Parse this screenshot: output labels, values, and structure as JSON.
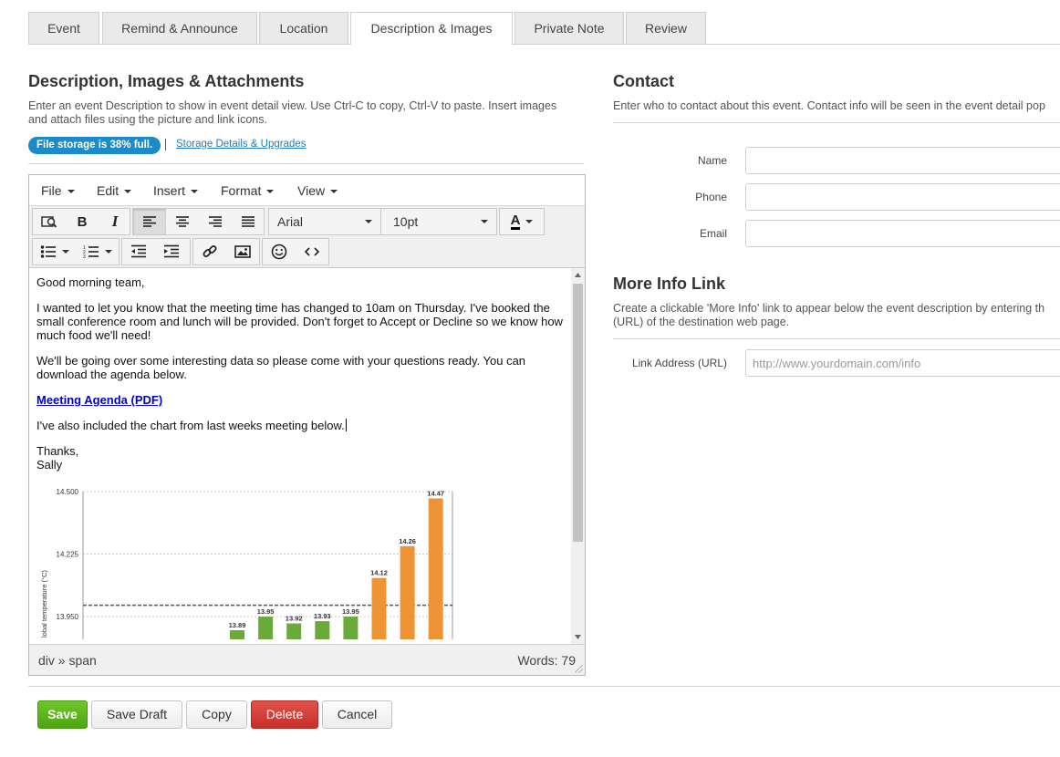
{
  "tabs": [
    {
      "label": "Event"
    },
    {
      "label": "Remind & Announce"
    },
    {
      "label": "Location"
    },
    {
      "label": "Description & Images"
    },
    {
      "label": "Private Note"
    },
    {
      "label": "Review"
    }
  ],
  "description_section": {
    "title": "Description, Images & Attachments",
    "help_text_1": "Enter an event Description to show in event detail view. Use Ctrl-C to copy, Ctrl-V to paste. Insert images",
    "help_text_2": "and attach files using the picture and link icons.",
    "storage_badge_prefix": "File storage is ",
    "storage_badge_percent": "38%",
    "storage_badge_suffix": " full.",
    "storage_link": "Storage Details & Upgrades"
  },
  "editor": {
    "menus": [
      "File",
      "Edit",
      "Insert",
      "Format",
      "View"
    ],
    "font_family": "Arial",
    "font_size": "10pt",
    "text_color_label": "A",
    "content": {
      "greeting": "Good morning team,",
      "para1": "I wanted to let you know that the meeting time has changed to 10am on Thursday. I've booked the small conference room and lunch will be provided. Don't forget to Accept or Decline so we know how much food we'll need!",
      "para2": "We'll be going over some interesting data so please come with your questions ready. You can download the agenda below.",
      "link": "Meeting Agenda (PDF)",
      "para3": "I've also included the chart from last weeks meeting below.",
      "signoff": "Thanks,",
      "signature": "Sally"
    },
    "status_path": "div » span",
    "word_count": "Words: 79"
  },
  "chart_data": {
    "type": "bar",
    "ylabel": "lobal temperature (°C)",
    "y_ticks": [
      "14.500",
      "14.225",
      "13.950"
    ],
    "ylim": [
      13.85,
      14.5
    ],
    "reference_line": 14.0,
    "values": [
      13.89,
      13.95,
      13.92,
      13.93,
      13.95,
      14.12,
      14.26,
      14.47
    ],
    "labels": [
      "13.89",
      "13.95",
      "13.92",
      "13.93",
      "13.95",
      "14.12",
      "14.26",
      "14.47"
    ],
    "colors": [
      "#6aaa3a",
      "#6aaa3a",
      "#6aaa3a",
      "#6aaa3a",
      "#6aaa3a",
      "#ee9336",
      "#ee9336",
      "#ee9336"
    ],
    "grid": true
  },
  "contact": {
    "title": "Contact",
    "help_text": "Enter who to contact about this event. Contact info will be seen in the event detail pop",
    "name_label": "Name",
    "phone_label": "Phone",
    "email_label": "Email",
    "name_value": "",
    "phone_value": "",
    "email_value": ""
  },
  "more_info": {
    "title": "More Info Link",
    "help_text_1": "Create a clickable 'More Info' link to appear below the event description by entering th",
    "help_text_2": "(URL) of the destination web page.",
    "url_label": "Link Address (URL)",
    "url_placeholder": "http://www.yourdomain.com/info"
  },
  "actions": {
    "save": "Save",
    "save_draft": "Save Draft",
    "copy": "Copy",
    "delete": "Delete",
    "cancel": "Cancel"
  },
  "colors": {
    "accent": "#1b8bc9",
    "save_green": "#5bb31d",
    "delete_red": "#d23c36"
  }
}
